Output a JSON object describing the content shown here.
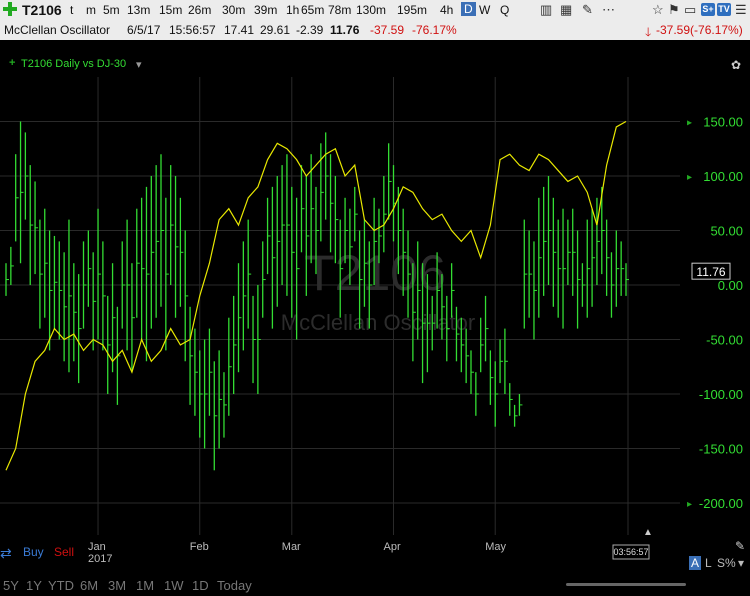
{
  "toolbar": {
    "symbol": "T2106",
    "timeframes": [
      "t",
      "m",
      "5m",
      "13m",
      "15m",
      "26m",
      "30m",
      "39m",
      "1h",
      "65m",
      "78m",
      "130m",
      "195m",
      "4h",
      "D",
      "W",
      "Q"
    ],
    "selected_timeframe": "D"
  },
  "quote": {
    "study": "McClellan Oscillator",
    "date": "6/5/17",
    "time": "15:56:57",
    "open": "17.41",
    "high": "29.61",
    "low": "-2.39",
    "last": "11.76",
    "change": "-37.59",
    "change_pct": "-76.17%",
    "right_change": "-37.59(-76.17%)"
  },
  "chart_header": {
    "title": "T2106 Daily vs DJ-30"
  },
  "watermark": {
    "symbol": "T2106",
    "study": "McClellan Oscillator"
  },
  "buttons": {
    "buy": "Buy",
    "sell": "Sell"
  },
  "current_value_label": "11.76",
  "time_label": "03:56:57",
  "bottom_ranges": [
    "5Y",
    "1Y",
    "YTD",
    "6M",
    "3M",
    "1M",
    "1W",
    "1D",
    "Today"
  ],
  "bottom_right": {
    "a": "A",
    "l": "L",
    "s": "S%"
  },
  "colors": {
    "bars": "#33dd33",
    "overlay": "#e8e800",
    "axis_text": "#33dd33",
    "up": "#22aa22",
    "down": "#d01010"
  },
  "chart_data": {
    "type": "bar",
    "ylim": [
      -210,
      160
    ],
    "yticks": [
      "150.00",
      "100.00",
      "50.00",
      "0.00",
      "-50.00",
      "-100.00",
      "-150.00",
      "-200.00"
    ],
    "ytick_values": [
      150,
      100,
      50,
      0,
      -50,
      -100,
      -150,
      -200
    ],
    "x_labels": [
      "Jan\n2017",
      "Feb",
      "Mar",
      "Apr",
      "May"
    ],
    "x_label_positions_day": [
      19,
      40,
      59,
      80,
      101
    ],
    "days": 129,
    "ohlc_hl": [
      [
        20,
        -10
      ],
      [
        35,
        0
      ],
      [
        120,
        40
      ],
      [
        150,
        20
      ],
      [
        140,
        60
      ],
      [
        110,
        0
      ],
      [
        95,
        10
      ],
      [
        60,
        -40
      ],
      [
        70,
        -30
      ],
      [
        50,
        -60
      ],
      [
        45,
        -40
      ],
      [
        40,
        -50
      ],
      [
        30,
        -70
      ],
      [
        60,
        -80
      ],
      [
        20,
        -70
      ],
      [
        10,
        -90
      ],
      [
        40,
        -40
      ],
      [
        50,
        -20
      ],
      [
        30,
        -60
      ],
      [
        70,
        -50
      ],
      [
        40,
        -60
      ],
      [
        -10,
        -100
      ],
      [
        20,
        -80
      ],
      [
        -20,
        -110
      ],
      [
        40,
        -40
      ],
      [
        60,
        -60
      ],
      [
        20,
        -80
      ],
      [
        70,
        -30
      ],
      [
        80,
        -50
      ],
      [
        90,
        -70
      ],
      [
        100,
        -40
      ],
      [
        110,
        -30
      ],
      [
        120,
        -20
      ],
      [
        80,
        -60
      ],
      [
        110,
        0
      ],
      [
        100,
        -30
      ],
      [
        80,
        -20
      ],
      [
        50,
        -70
      ],
      [
        -20,
        -110
      ],
      [
        -40,
        -120
      ],
      [
        -60,
        -140
      ],
      [
        -50,
        -150
      ],
      [
        -40,
        -120
      ],
      [
        -70,
        -170
      ],
      [
        -60,
        -150
      ],
      [
        -80,
        -140
      ],
      [
        -30,
        -120
      ],
      [
        -10,
        -100
      ],
      [
        20,
        -80
      ],
      [
        40,
        -60
      ],
      [
        60,
        -40
      ],
      [
        -10,
        -90
      ],
      [
        0,
        -100
      ],
      [
        40,
        -30
      ],
      [
        80,
        10
      ],
      [
        90,
        -40
      ],
      [
        100,
        -20
      ],
      [
        110,
        0
      ],
      [
        120,
        -10
      ],
      [
        90,
        -30
      ],
      [
        80,
        -50
      ],
      [
        110,
        30
      ],
      [
        100,
        -10
      ],
      [
        120,
        20
      ],
      [
        90,
        10
      ],
      [
        130,
        40
      ],
      [
        140,
        60
      ],
      [
        120,
        30
      ],
      [
        100,
        20
      ],
      [
        60,
        -30
      ],
      [
        80,
        20
      ],
      [
        70,
        0
      ],
      [
        90,
        40
      ],
      [
        50,
        -40
      ],
      [
        60,
        -20
      ],
      [
        40,
        -40
      ],
      [
        80,
        0
      ],
      [
        70,
        20
      ],
      [
        100,
        30
      ],
      [
        130,
        60
      ],
      [
        110,
        40
      ],
      [
        90,
        10
      ],
      [
        70,
        -10
      ],
      [
        50,
        -30
      ],
      [
        20,
        -70
      ],
      [
        40,
        -50
      ],
      [
        20,
        -90
      ],
      [
        10,
        -80
      ],
      [
        -10,
        -60
      ],
      [
        30,
        -40
      ],
      [
        10,
        -50
      ],
      [
        -10,
        -70
      ],
      [
        20,
        -30
      ],
      [
        -20,
        -70
      ],
      [
        -30,
        -80
      ],
      [
        -40,
        -90
      ],
      [
        -60,
        -100
      ],
      [
        -80,
        -120
      ],
      [
        -30,
        -80
      ],
      [
        -10,
        -70
      ],
      [
        -60,
        -110
      ],
      [
        -70,
        -130
      ],
      [
        -50,
        -90
      ],
      [
        -40,
        -100
      ],
      [
        -90,
        -120
      ],
      [
        -110,
        -130
      ],
      [
        -100,
        -120
      ],
      [
        60,
        -40
      ],
      [
        50,
        -30
      ],
      [
        40,
        -50
      ],
      [
        80,
        -30
      ],
      [
        90,
        -10
      ],
      [
        100,
        0
      ],
      [
        80,
        -20
      ],
      [
        60,
        -30
      ],
      [
        70,
        -40
      ],
      [
        60,
        0
      ],
      [
        70,
        -10
      ],
      [
        50,
        -40
      ],
      [
        20,
        -20
      ],
      [
        60,
        -30
      ],
      [
        70,
        -20
      ],
      [
        80,
        0
      ],
      [
        90,
        10
      ],
      [
        60,
        -10
      ],
      [
        30,
        -30
      ],
      [
        50,
        -20
      ],
      [
        40,
        -10
      ],
      [
        20,
        -10
      ]
    ],
    "overlay_days": [
      0,
      2,
      4,
      6,
      8,
      10,
      12,
      14,
      16,
      18,
      20,
      22,
      24,
      26,
      28,
      30,
      32,
      34,
      36,
      38,
      40,
      42,
      44,
      46,
      48,
      50,
      52,
      54,
      56,
      58,
      60,
      62,
      64,
      66,
      68,
      70,
      72,
      74,
      76,
      78,
      80,
      82,
      84,
      86,
      88,
      90,
      92,
      94,
      96,
      98,
      100,
      102,
      104,
      106,
      108,
      110,
      112,
      114,
      116,
      118,
      120,
      122,
      124,
      126,
      128
    ],
    "overlay_values": [
      -170,
      -150,
      -100,
      -70,
      -60,
      -40,
      -50,
      -45,
      -60,
      -50,
      -55,
      -70,
      -60,
      -80,
      -50,
      -70,
      -60,
      -40,
      -55,
      -50,
      -10,
      20,
      60,
      70,
      55,
      80,
      90,
      115,
      130,
      125,
      115,
      100,
      110,
      120,
      125,
      100,
      110,
      60,
      50,
      55,
      70,
      90,
      85,
      70,
      60,
      65,
      50,
      40,
      50,
      25,
      55,
      115,
      120,
      110,
      105,
      120,
      115,
      105,
      95,
      100,
      85,
      55,
      110,
      145,
      150
    ]
  }
}
